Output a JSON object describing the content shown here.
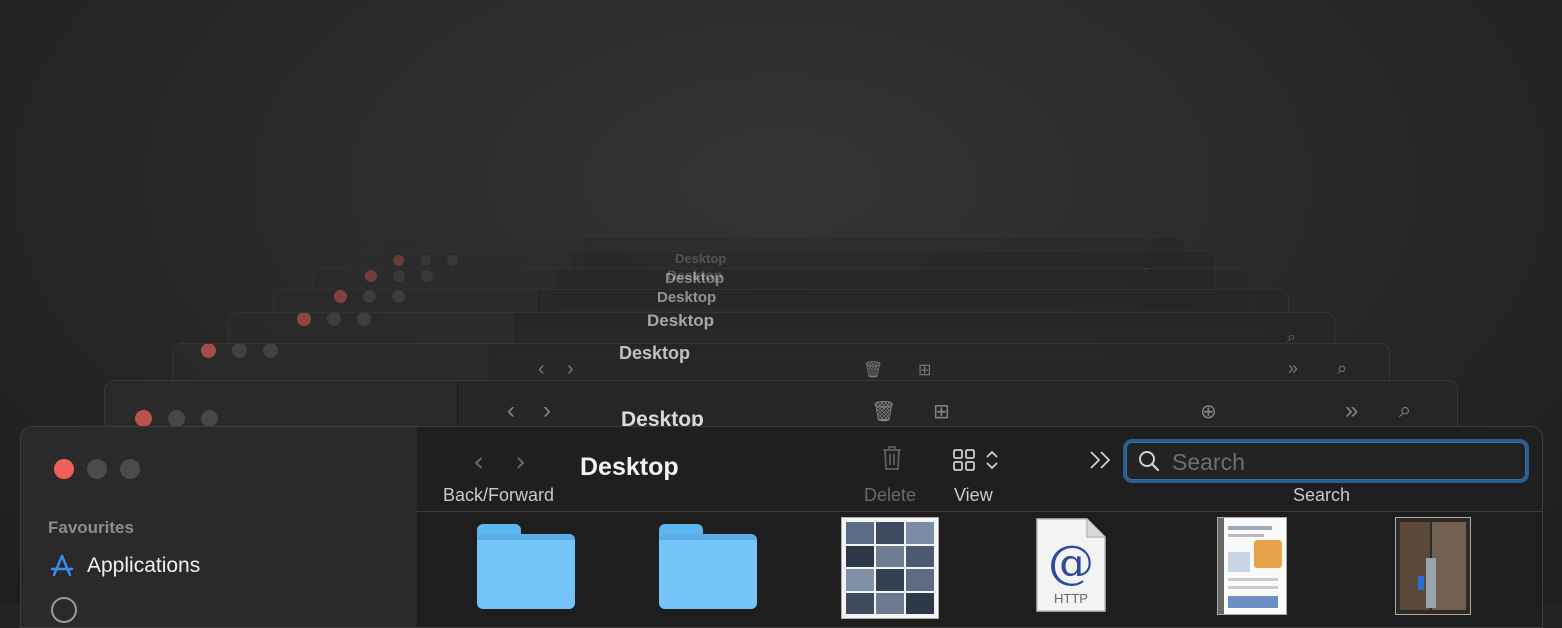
{
  "ghost_windows": [
    {
      "title": "Desktop"
    },
    {
      "title": "Desktop"
    },
    {
      "title": "Desktop"
    },
    {
      "title": "Desktop"
    },
    {
      "title": "Desktop"
    },
    {
      "title": "Desktop"
    },
    {
      "title": "Desktop"
    }
  ],
  "window": {
    "title": "Desktop",
    "toolbar": {
      "back_forward_label": "Back/Forward",
      "delete_label": "Delete",
      "view_label": "View",
      "search_label": "Search",
      "search_placeholder": "Search"
    },
    "sidebar": {
      "section_heading": "Favourites",
      "items": [
        {
          "label": "Applications",
          "icon": "app-store-icon"
        }
      ]
    },
    "files": [
      {
        "kind": "folder"
      },
      {
        "kind": "folder"
      },
      {
        "kind": "image-thumbnail"
      },
      {
        "kind": "webloc",
        "badge": "HTTP"
      },
      {
        "kind": "document-thumbnail"
      },
      {
        "kind": "image-thumbnail"
      }
    ]
  },
  "colors": {
    "close": "#ee5f57",
    "search_focus_ring": "#2a5d91",
    "folder": "#74c4f7"
  }
}
